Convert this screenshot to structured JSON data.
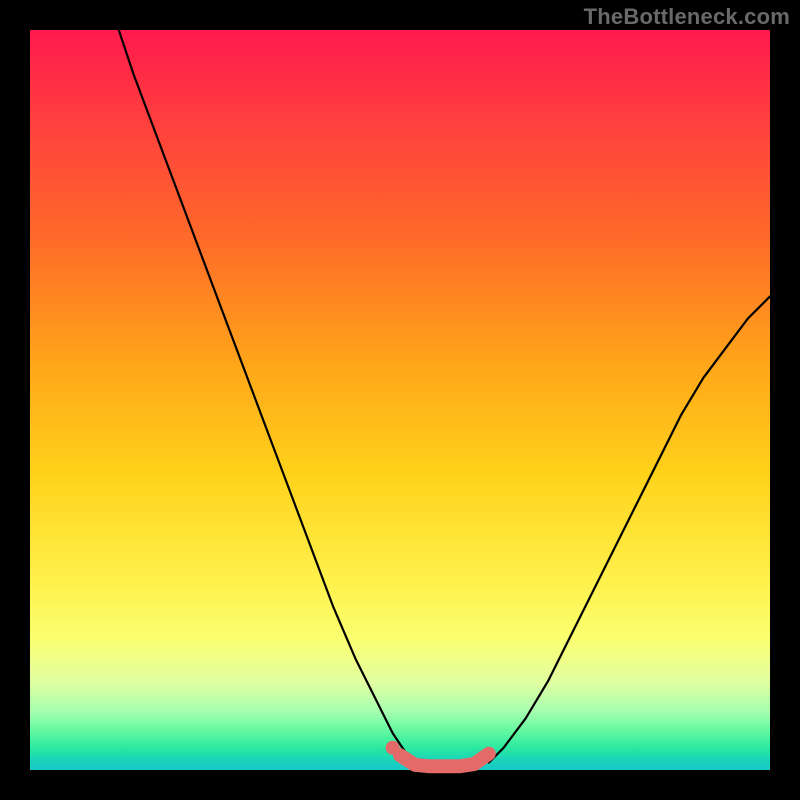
{
  "watermark": "TheBottleneck.com",
  "chart_data": {
    "type": "line",
    "title": "",
    "xlabel": "",
    "ylabel": "",
    "xlim": [
      0,
      100
    ],
    "ylim": [
      0,
      100
    ],
    "grid": false,
    "legend": false,
    "background_gradient": {
      "top": "#ff1a4d",
      "bottom": "#17c8c8",
      "stops": [
        "red",
        "orange",
        "yellow",
        "green",
        "teal"
      ]
    },
    "series": [
      {
        "name": "left-curve",
        "stroke": "#000000",
        "x": [
          12,
          14,
          17,
          20,
          23,
          26,
          29,
          32,
          35,
          38,
          41,
          44,
          47,
          49,
          51,
          52.5
        ],
        "y": [
          100,
          94,
          86,
          78,
          70,
          62,
          54,
          46,
          38,
          30,
          22,
          15,
          9,
          5,
          2,
          1
        ]
      },
      {
        "name": "right-curve",
        "stroke": "#000000",
        "x": [
          62,
          64,
          67,
          70,
          73,
          76,
          79,
          82,
          85,
          88,
          91,
          94,
          97,
          100
        ],
        "y": [
          1,
          3,
          7,
          12,
          18,
          24,
          30,
          36,
          42,
          48,
          53,
          57,
          61,
          64
        ]
      },
      {
        "name": "tolerance-band",
        "stroke": "#e46a6a",
        "x": [
          50,
          52,
          54,
          56,
          58,
          60,
          62
        ],
        "y": [
          2.0,
          0.7,
          0.5,
          0.5,
          0.5,
          0.8,
          2.2
        ]
      }
    ],
    "markers": [
      {
        "name": "tolerance-dot",
        "x": 49,
        "y": 3,
        "color": "#e46a6a"
      }
    ],
    "annotations": []
  }
}
